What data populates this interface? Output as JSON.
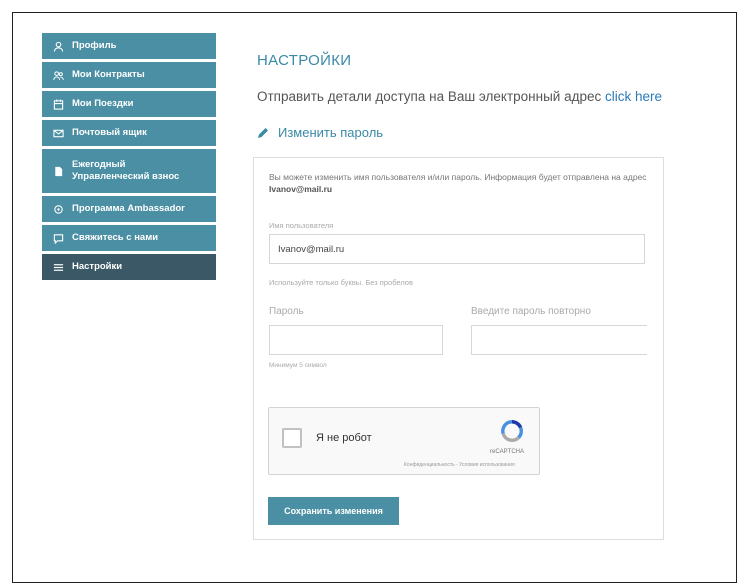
{
  "sidebar": {
    "items": [
      {
        "label": "Профиль",
        "icon": "user-icon"
      },
      {
        "label": "Мои Контракты",
        "icon": "users-icon"
      },
      {
        "label": "Мои Поездки",
        "icon": "calendar-icon"
      },
      {
        "label": "Почтовый ящик",
        "icon": "mail-icon"
      },
      {
        "label": "Ежегодный Управленческий взнос",
        "icon": "document-icon"
      },
      {
        "label": "Программа Ambassador",
        "icon": "star-icon"
      },
      {
        "label": "Свяжитесь с нами",
        "icon": "contact-icon"
      },
      {
        "label": "Настройки",
        "icon": "settings-icon",
        "active": true
      }
    ]
  },
  "main": {
    "title": "НАСТРОЙКИ",
    "send_text": "Отправить детали доступа на Ваш электронный адрес",
    "send_link": "click here",
    "change_password": "Изменить пароль",
    "info_text": "Вы можете изменить имя пользователя и/или пароль. Информация будет отправлена на адрес",
    "info_email": "Ivanov@mail.ru",
    "username_label": "Имя пользователя",
    "username_value": "Ivanov@mail.ru",
    "username_hint": "Используйте только буквы. Без пробелов",
    "password_label": "Пароль",
    "password_repeat_label": "Введите пароль повторно",
    "password_hint": "Минимум 5 символ"
  },
  "captcha": {
    "label": "Я не робот",
    "brand": "reCAPTCHA",
    "terms": "Конфиденциальность - Условия использования"
  },
  "save_button": "Сохранить изменения",
  "colors": {
    "sidebar": "#4a8fa3",
    "sidebar_active": "#3b5866",
    "title": "#3b8aa6",
    "link": "#2b7bb8"
  }
}
